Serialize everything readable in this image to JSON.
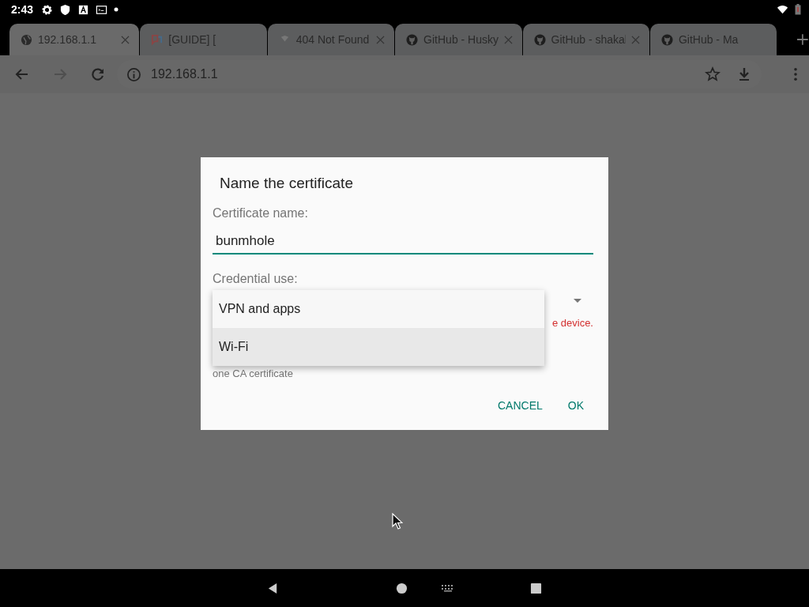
{
  "status_bar": {
    "time": "2:43"
  },
  "tabs": [
    {
      "title": "192.168.1.1",
      "selected": true,
      "closable": true
    },
    {
      "title": "[GUIDE] [",
      "selected": false,
      "closable": false
    },
    {
      "title": "404 Not Found",
      "selected": false,
      "closable": true
    },
    {
      "title": "GitHub - Husky",
      "selected": false,
      "closable": true
    },
    {
      "title": "GitHub - shakal",
      "selected": false,
      "closable": true
    },
    {
      "title": "GitHub - Ma",
      "selected": false,
      "closable": false
    }
  ],
  "address_bar": {
    "url": "192.168.1.1"
  },
  "dialog": {
    "title": "Name the certificate",
    "name_label": "Certificate name:",
    "name_value": "bunmhole",
    "use_label": "Credential use:",
    "warning": "e device.",
    "note": "one CA certificate",
    "buttons": [
      "CANCEL",
      "OK"
    ]
  },
  "dropdown": {
    "options": [
      {
        "label": "VPN and apps",
        "selected": false
      },
      {
        "label": "Wi-Fi",
        "selected": true
      }
    ]
  }
}
